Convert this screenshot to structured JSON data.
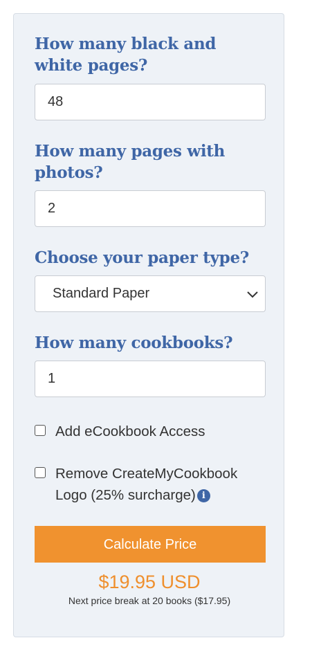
{
  "form": {
    "bw_pages": {
      "question": "How many black and white pages?",
      "value": "48"
    },
    "photo_pages": {
      "question": "How many pages with photos?",
      "value": "2"
    },
    "paper_type": {
      "question": "Choose your paper type?",
      "selected": "Standard Paper",
      "icon": "chevron-down-icon"
    },
    "cookbooks": {
      "question": "How many cookbooks?",
      "value": "1"
    },
    "ecookbook": {
      "label": "Add eCookbook Access",
      "checked": false
    },
    "remove_logo": {
      "label": "Remove CreateMyCookbook Logo (25% surcharge)",
      "checked": false,
      "icon": "info-icon"
    },
    "calculate_label": "Calculate Price"
  },
  "result": {
    "price": "$19.95 USD",
    "note": "Next price break at 20 books ($17.95)"
  },
  "colors": {
    "heading": "#3f66a6",
    "accent": "#f0922f",
    "panel_bg": "#eef2f7"
  }
}
